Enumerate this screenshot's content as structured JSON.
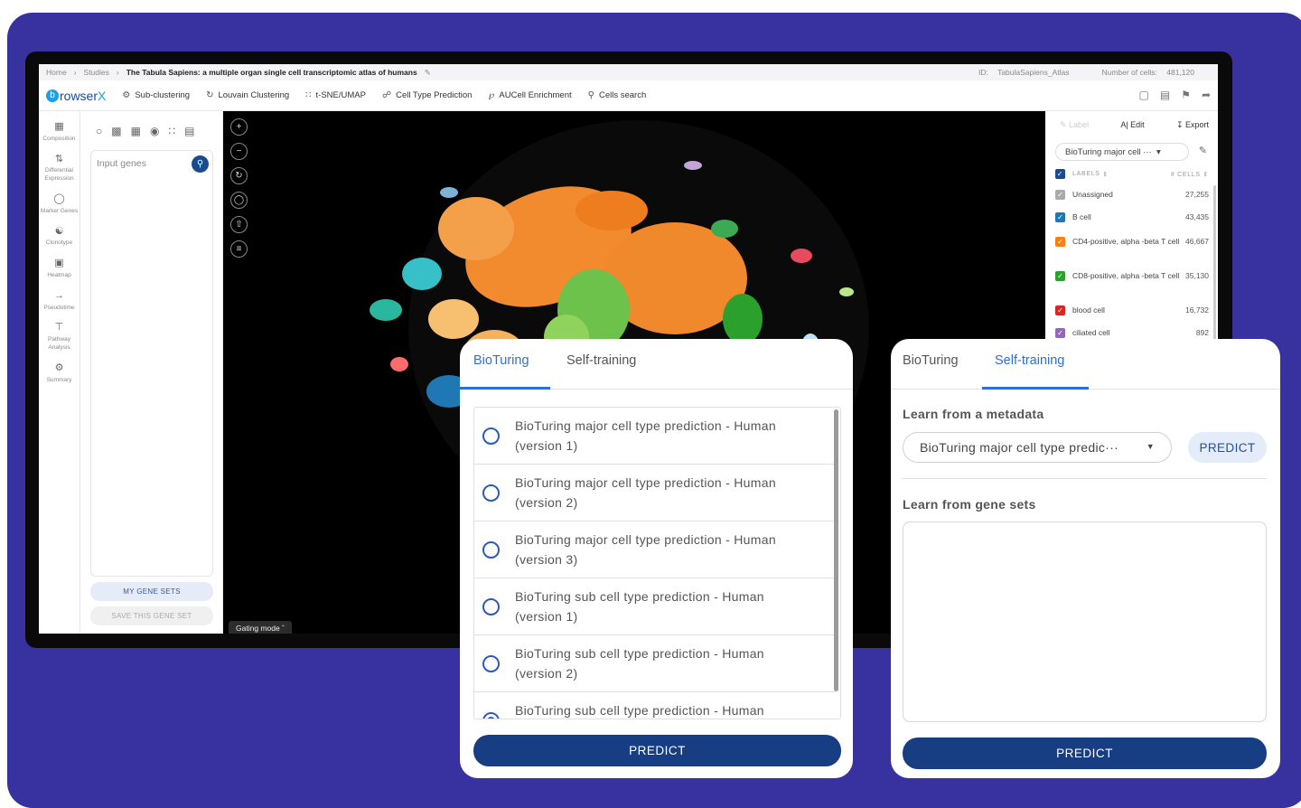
{
  "breadcrumb": {
    "home": "Home",
    "studies": "Studies",
    "study_title": "The Tabula Sapiens: a multiple organ single cell transcriptomic atlas of humans",
    "id_label": "ID:",
    "id_value": "TabulaSapiens_Atlas",
    "cells_label": "Number of cells:",
    "cells_value": "481,120"
  },
  "toolbar": {
    "logo_b": "b",
    "logo_text": "rowser",
    "logo_x": "X",
    "items": [
      {
        "label": "Sub-clustering",
        "icon": "sub-clustering-icon"
      },
      {
        "label": "Louvain Clustering",
        "icon": "louvain-icon"
      },
      {
        "label": "t-SNE/UMAP",
        "icon": "tsne-icon"
      },
      {
        "label": "Cell Type Prediction",
        "icon": "prediction-icon"
      },
      {
        "label": "AUCell Enrichment",
        "icon": "aucell-icon"
      },
      {
        "label": "Cells search",
        "icon": "search-icon"
      }
    ]
  },
  "rail": [
    {
      "label": "Composition"
    },
    {
      "label": "Differential Expression"
    },
    {
      "label": "Marker Genes"
    },
    {
      "label": "Clonotype"
    },
    {
      "label": "Heatmap"
    },
    {
      "label": "Pseudotime"
    },
    {
      "label": "Pathway Analysis"
    },
    {
      "label": "Summary"
    }
  ],
  "gene_panel": {
    "input_placeholder": "Input genes",
    "my_gene_sets": "MY GENE SETS",
    "save_gene_set": "SAVE THIS GENE SET"
  },
  "plot": {
    "gating_mode": "Gating mode"
  },
  "label_panel": {
    "label_btn": "Label",
    "edit_btn": "Edit",
    "export_btn": "Export",
    "selected_metadata": "BioTuring major cell ···",
    "col_labels": "LABELS",
    "col_cells": "# CELLS",
    "rows": [
      {
        "name": "Unassigned",
        "count": "27,255",
        "color": "#aaaaaa"
      },
      {
        "name": "B cell",
        "count": "43,435",
        "color": "#1f77b4"
      },
      {
        "name": "CD4-positive, alpha -beta T cell",
        "count": "46,667",
        "color": "#ff7f0e"
      },
      {
        "name": "CD8-positive, alpha -beta T cell",
        "count": "35,130",
        "color": "#2ca02c"
      },
      {
        "name": "blood cell",
        "count": "16,732",
        "color": "#d62728"
      },
      {
        "name": "ciliated cell",
        "count": "892",
        "color": "#9467bd"
      }
    ]
  },
  "card_left": {
    "tab1": "BioTuring",
    "tab2": "Self-training",
    "options": [
      {
        "label": "BioTuring major cell type prediction - Human (version 1)",
        "selected": false
      },
      {
        "label": "BioTuring major cell type prediction - Human (version 2)",
        "selected": false
      },
      {
        "label": "BioTuring major cell type prediction - Human (version 3)",
        "selected": false
      },
      {
        "label": "BioTuring sub cell type prediction - Human (version 1)",
        "selected": false
      },
      {
        "label": "BioTuring sub cell type prediction - Human (version 2)",
        "selected": false
      },
      {
        "label": "BioTuring sub cell type prediction - Human",
        "selected": true
      }
    ],
    "predict": "PREDICT"
  },
  "card_right": {
    "tab1": "BioTuring",
    "tab2": "Self-training",
    "metadata_title": "Learn from a metadata",
    "metadata_value": "BioTuring major cell type predic···",
    "predict_small": "PREDICT",
    "genesets_title": "Learn from gene sets",
    "predict": "PREDICT"
  },
  "colors": {
    "background": "#3732a0",
    "primary": "#173d82",
    "accent": "#2f6fd0"
  }
}
